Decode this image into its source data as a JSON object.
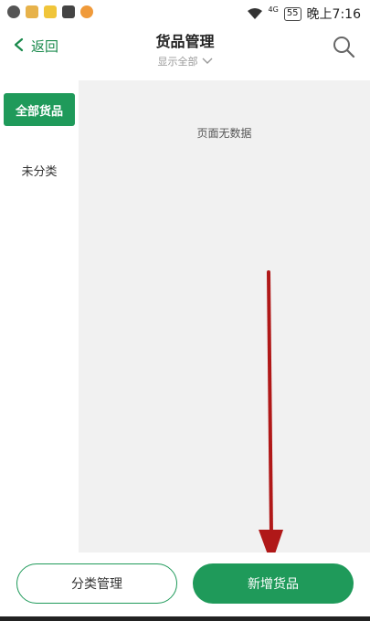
{
  "status_bar": {
    "battery": "55",
    "signal": "4G",
    "time": "晚上7:16",
    "app_icons": [
      "message-icon",
      "notes-icon",
      "smile-app-icon",
      "mail-icon",
      "face-app-icon"
    ]
  },
  "header": {
    "back_label": "返回",
    "title": "货品管理",
    "filter_label": "显示全部"
  },
  "sidebar": {
    "items": [
      {
        "label": "全部货品",
        "active": true
      },
      {
        "label": "未分类",
        "active": false
      }
    ]
  },
  "content": {
    "empty_message": "页面无数据"
  },
  "bottom": {
    "manage_label": "分类管理",
    "add_label": "新增货品"
  },
  "colors": {
    "accent": "#1f9a5a",
    "annotation": "#b01818"
  }
}
